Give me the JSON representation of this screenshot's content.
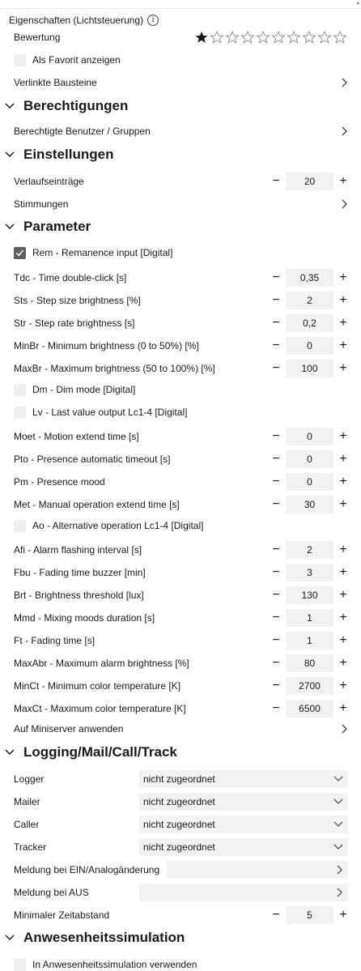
{
  "title": "Eigenschaften (Lichtsteuerung)",
  "info_icon": "info-icon",
  "rating": {
    "label": "Bewertung",
    "filled": 1,
    "total": 10
  },
  "favorite": {
    "label": "Als Favorit anzeigen",
    "checked": false
  },
  "linked_blocks": {
    "label": "Verlinkte Bausteine"
  },
  "sections": {
    "permissions": "Berechtigungen",
    "settings": "Einstellungen",
    "parameters": "Parameter",
    "logging": "Logging/Mail/Call/Track",
    "presence": "Anwesenheitssimulation"
  },
  "permissions": {
    "users_label": "Berechtigte Benutzer / Gruppen"
  },
  "settings": {
    "history_label": "Verlaufseinträge",
    "history_value": "20",
    "moods_label": "Stimmungen"
  },
  "params": {
    "rem": {
      "label": "Rem - Remanence input [Digital]",
      "checked": true
    },
    "tdc": {
      "label": "Tdc - Time double-click [s]",
      "value": "0,35"
    },
    "sts": {
      "label": "Sts - Step size brightness [%]",
      "value": "2"
    },
    "str": {
      "label": "Str - Step rate brightness [s]",
      "value": "0,2"
    },
    "minbr": {
      "label": "MinBr - Minimum brightness (0 to 50%) [%]",
      "value": "0"
    },
    "maxbr": {
      "label": "MaxBr - Maximum brightness (50 to 100%) [%]",
      "value": "100"
    },
    "dm": {
      "label": "Dm - Dim mode [Digital]",
      "checked": false
    },
    "lv": {
      "label": "Lv - Last value output Lc1-4 [Digital]",
      "checked": false
    },
    "moet": {
      "label": "Moet - Motion extend time [s]",
      "value": "0"
    },
    "pto": {
      "label": "Pto - Presence automatic timeout [s]",
      "value": "0"
    },
    "pm": {
      "label": "Pm - Presence mood",
      "value": "0"
    },
    "met": {
      "label": "Met - Manual operation extend time [s]",
      "value": "30"
    },
    "ao": {
      "label": "Ao - Alternative operation Lc1-4 [Digital]",
      "checked": false
    },
    "afi": {
      "label": "Afi - Alarm flashing interval [s]",
      "value": "2"
    },
    "fbu": {
      "label": "Fbu - Fading time buzzer [min]",
      "value": "3"
    },
    "brt": {
      "label": "Brt - Brightness threshold [lux]",
      "value": "130"
    },
    "mmd": {
      "label": "Mmd - Mixing moods duration [s]",
      "value": "1"
    },
    "ft": {
      "label": "Ft - Fading time [s]",
      "value": "1"
    },
    "maxabr": {
      "label": "MaxAbr - Maximum alarm brightness [%]",
      "value": "80"
    },
    "minct": {
      "label": "MinCt - Minimum color temperature [K]",
      "value": "2700"
    },
    "maxct": {
      "label": "MaxCt - Maximum color temperature [K]",
      "value": "6500"
    },
    "apply": {
      "label": "Auf Miniserver anwenden"
    }
  },
  "logging": {
    "logger": {
      "label": "Logger",
      "value": "nicht zugeordnet"
    },
    "mailer": {
      "label": "Mailer",
      "value": "nicht zugeordnet"
    },
    "caller": {
      "label": "Caller",
      "value": "nicht zugeordnet"
    },
    "tracker": {
      "label": "Tracker",
      "value": "nicht zugeordnet"
    },
    "msg_on": {
      "label": "Meldung bei EIN/Analogänderung"
    },
    "msg_off": {
      "label": "Meldung bei AUS"
    },
    "min_interval": {
      "label": "Minimaler Zeitabstand",
      "value": "5"
    }
  },
  "presence": {
    "use_label": "In Anwesenheitssimulation verwenden",
    "checked": false
  },
  "stepper": {
    "minus": "−",
    "plus": "+"
  },
  "colors": {
    "accent": "#1a1a1a",
    "field_bg": "#f2f2f2",
    "checkbox_bg": "#eeeeee",
    "checkbox_checked": "#5f5f5f"
  }
}
